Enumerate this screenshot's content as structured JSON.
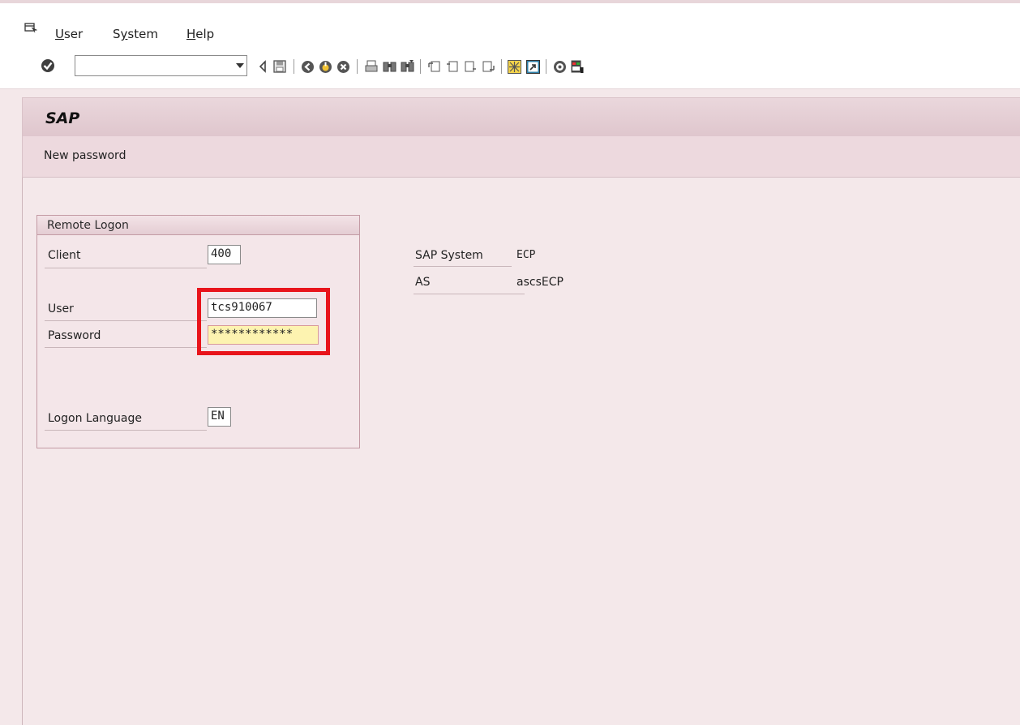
{
  "menu": {
    "items": [
      {
        "accel": "U",
        "rest": "ser"
      },
      {
        "pre": "S",
        "accel": "y",
        "rest": "stem"
      },
      {
        "accel": "H",
        "rest": "elp"
      }
    ]
  },
  "toolbar": {
    "command_value": "",
    "icons": [
      "enter-icon",
      "back-icon",
      "save-icon",
      "back-nav-icon",
      "exit-icon",
      "cancel-icon",
      "print-icon",
      "find-icon",
      "find-next-icon",
      "first-page-icon",
      "prev-page-icon",
      "next-page-icon",
      "last-page-icon",
      "new-session-icon",
      "shortcut-icon",
      "help-icon",
      "layout-menu-icon"
    ]
  },
  "screen": {
    "title": "SAP",
    "app_button": "New password"
  },
  "logon": {
    "group_title": "Remote Logon",
    "client_label": "Client",
    "client_value": "400",
    "user_label": "User",
    "user_value": "tcs910067",
    "password_label": "Password",
    "password_value": "************",
    "language_label": "Logon Language",
    "language_value": "EN"
  },
  "system_info": {
    "sap_system_label": "SAP System",
    "sap_system_value": "ECP",
    "as_label": "AS",
    "as_value": "ascsECP"
  },
  "colors": {
    "background": "#f4e8ea",
    "highlight": "#e8141b",
    "password_field": "#fdf3b0"
  }
}
